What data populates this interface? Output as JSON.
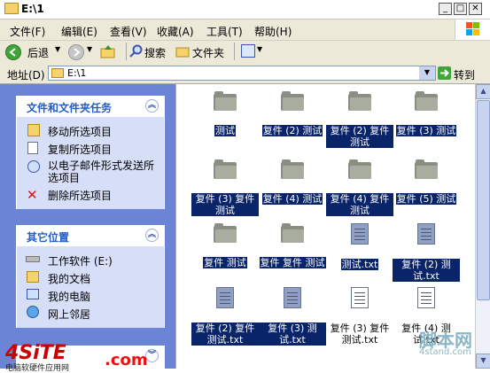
{
  "window": {
    "title": "E:\\1"
  },
  "menu": [
    "文件(F)",
    "编辑(E)",
    "查看(V)",
    "收藏(A)",
    "工具(T)",
    "帮助(H)"
  ],
  "toolbar": {
    "back": "后退",
    "search": "搜索",
    "folders": "文件夹"
  },
  "address": {
    "label": "地址(D)",
    "value": "E:\\1",
    "go": "转到"
  },
  "tasks": {
    "title": "文件和文件夹任务",
    "items": [
      "移动所选项目",
      "复制所选项目",
      "以电子邮件形式发送所选项目",
      "删除所选项目"
    ]
  },
  "places": {
    "title": "其它位置",
    "items": [
      "工作软件 (E:)",
      "我的文档",
      "我的电脑",
      "网上邻居"
    ]
  },
  "files": [
    {
      "name": "测试",
      "type": "folder",
      "selected": true
    },
    {
      "name": "复件 (2) 测试",
      "type": "folder",
      "selected": true
    },
    {
      "name": "复件 (2) 复件 测试",
      "type": "folder",
      "selected": true
    },
    {
      "name": "复件 (3) 测试",
      "type": "folder",
      "selected": true
    },
    {
      "name": "复件 (3) 复件 测试",
      "type": "folder",
      "selected": true
    },
    {
      "name": "复件 (4) 测试",
      "type": "folder",
      "selected": true
    },
    {
      "name": "复件 (4) 复件 测试",
      "type": "folder",
      "selected": true
    },
    {
      "name": "复件 (5) 测试",
      "type": "folder",
      "selected": true
    },
    {
      "name": "复件 测试",
      "type": "folder",
      "selected": true
    },
    {
      "name": "复件 复件 测试",
      "type": "folder",
      "selected": true
    },
    {
      "name": "测试.txt",
      "type": "txt",
      "selected": true
    },
    {
      "name": "复件 (2) 测试.txt",
      "type": "txt",
      "selected": true
    },
    {
      "name": "复件 (2) 复件 测试.txt",
      "type": "txt",
      "selected": true
    },
    {
      "name": "复件 (3) 测试.txt",
      "type": "txt",
      "selected": true
    },
    {
      "name": "复件 (3) 复件 测试.txt",
      "type": "txt",
      "selected": false
    },
    {
      "name": "复件 (4) 测试.txt",
      "type": "txt",
      "selected": false
    }
  ],
  "watermarks": {
    "left_logo": "4SiTE",
    "left_sub": "电脑软硬件应用网",
    "left_com": ".com",
    "right_logo": "脚本网",
    "right_sub": "4stand.com"
  },
  "colors": {
    "selection": "#0a246a",
    "task_pane": "#6b84d6",
    "panel_body": "#d6dff7",
    "heading": "#215dc6"
  }
}
